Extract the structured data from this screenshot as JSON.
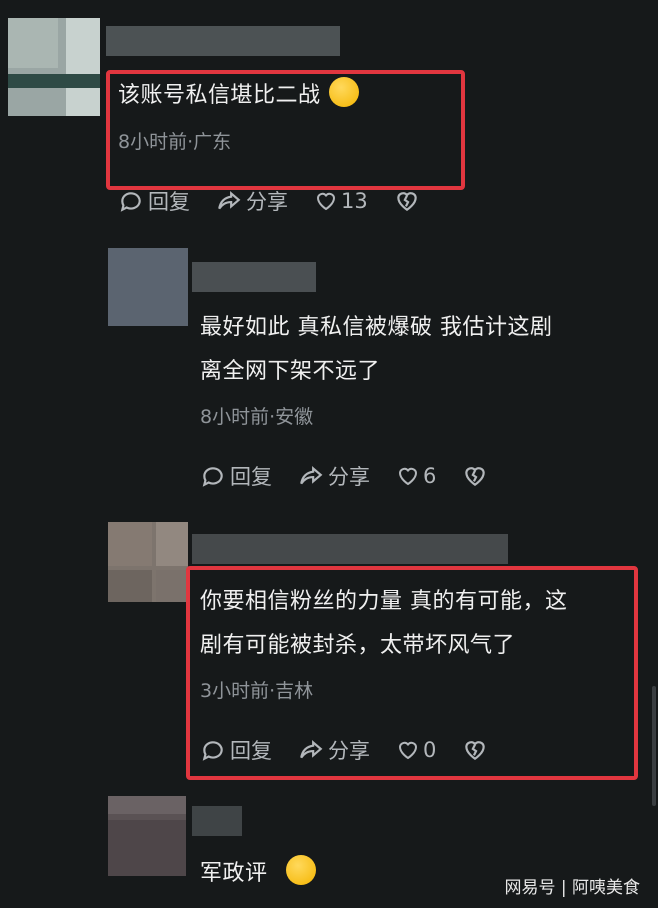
{
  "comments": [
    {
      "text": "该账号私信堪比二战",
      "meta": "8小时前·广东",
      "reply": "回复",
      "share": "分享",
      "likes": "13",
      "emoji": "crying-laughing-emoji"
    },
    {
      "text_line1": "最好如此 真私信被爆破 我估计这剧",
      "text_line2": "离全网下架不远了",
      "meta": "8小时前·安徽",
      "reply": "回复",
      "share": "分享",
      "likes": "6"
    },
    {
      "text_line1": "你要相信粉丝的力量 真的有可能，这",
      "text_line2": "剧有可能被封杀，太带坏风气了",
      "meta": "3小时前·吉林",
      "reply": "回复",
      "share": "分享",
      "likes": "0"
    },
    {
      "text": "军政评",
      "emoji": "thinking-emoji"
    }
  ],
  "watermark": "网易号 | 阿咦美食",
  "colors": {
    "background": "#16191a",
    "highlight": "#e1363f",
    "meta": "#8f9499"
  }
}
